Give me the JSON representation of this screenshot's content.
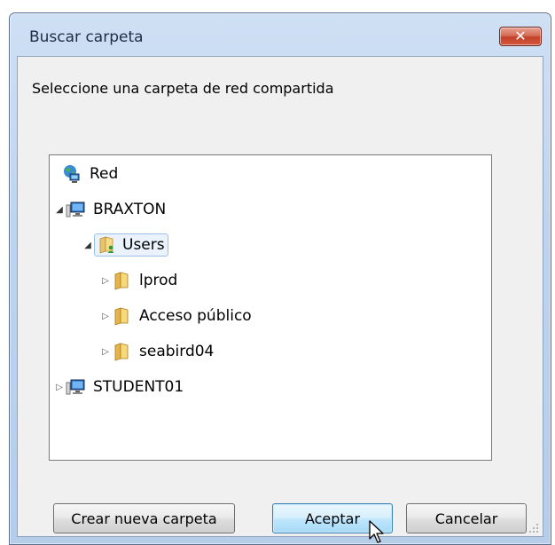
{
  "window": {
    "title": "Buscar carpeta",
    "close_label": "✕"
  },
  "prompt": "Seleccione una carpeta de red compartida",
  "tree": {
    "network": "Red",
    "computer1": "BRAXTON",
    "users": "Users",
    "children": [
      "lprod",
      "Acceso público",
      "seabird04"
    ],
    "computer2": "STUDENT01"
  },
  "buttons": {
    "new_folder": "Crear nueva carpeta",
    "ok": "Aceptar",
    "cancel": "Cancelar"
  },
  "colors": {
    "frame": "#bed3ee",
    "close": "#c4412a",
    "selection": "#eaf3fc",
    "primary_button": "#bee6fd"
  },
  "icons": {
    "network": "network-globe-icon",
    "computer": "computer-monitor-icon",
    "user_folder": "user-folder-icon",
    "folder": "folder-icon"
  }
}
